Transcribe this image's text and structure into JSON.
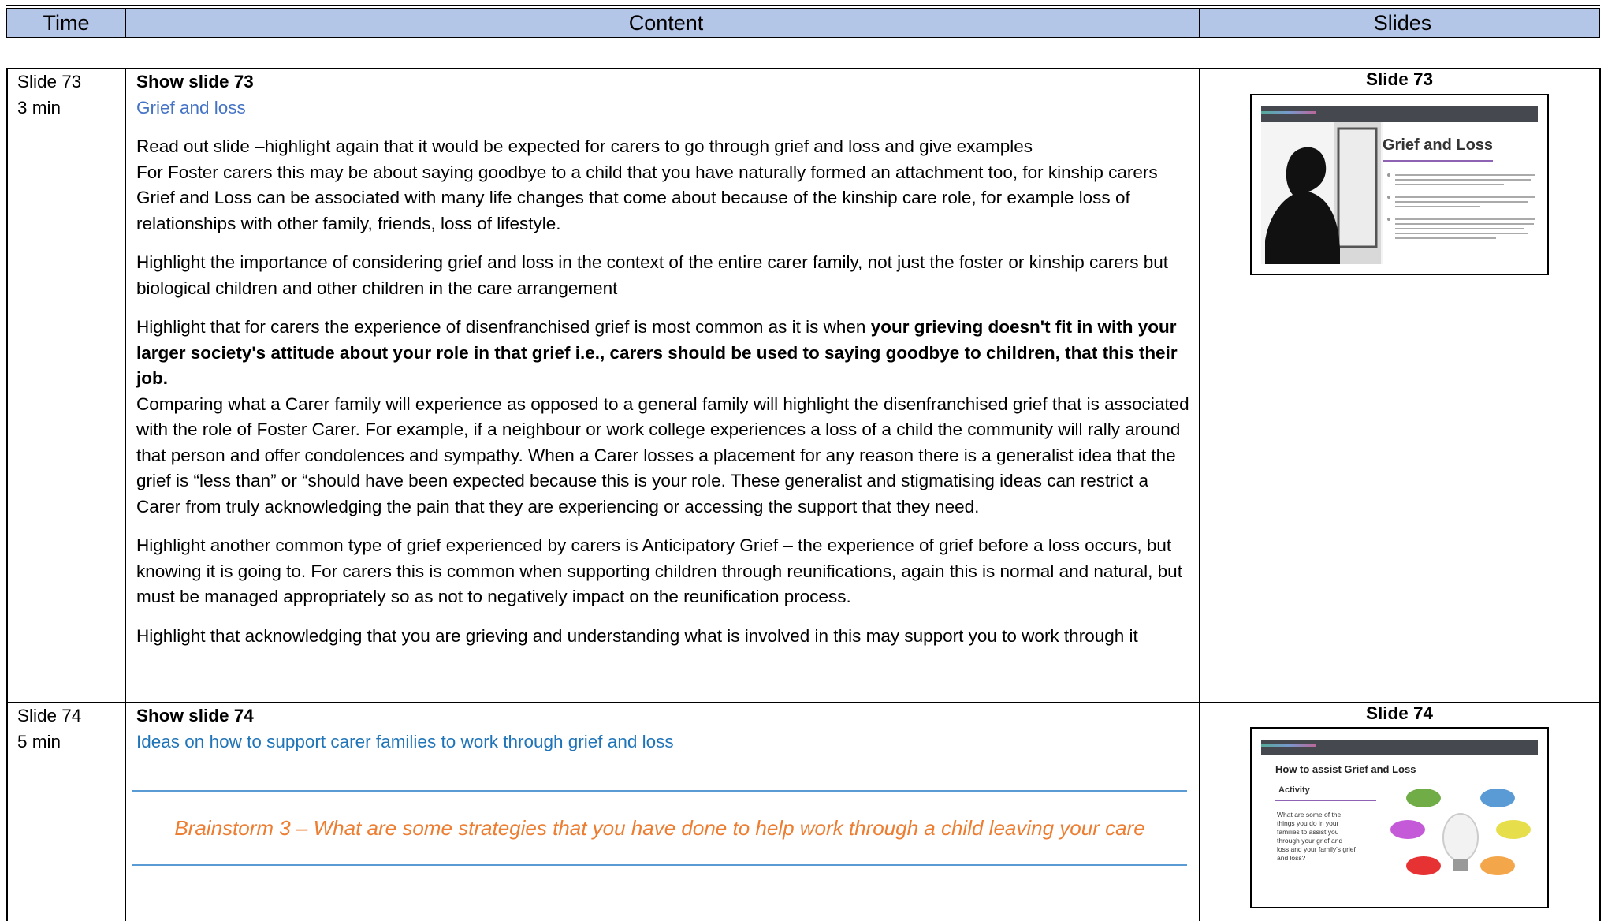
{
  "header": {
    "time": "Time",
    "content": "Content",
    "slides": "Slides"
  },
  "row73": {
    "time_slide": "Slide 73",
    "time_min": "3 min",
    "show": "Show slide 73",
    "subtitle": "Grief and loss",
    "p1_line1": "Read out slide –highlight again that it would be expected for carers to go through grief and loss and give examples",
    "p1_line2": "For Foster carers this may be about saying goodbye to a child that you have naturally formed an attachment too, for kinship carers Grief and Loss can be associated with many life changes that come about because of the kinship care role, for example loss of relationships with other family, friends, loss of lifestyle.",
    "p2": "Highlight the importance of considering grief and loss in the context of the entire carer family, not just the foster or kinship carers but biological children and other children in the care arrangement",
    "p3_plain": "Highlight that for carers the experience of disenfranchised grief is most common as it is when ",
    "p3_bold": "your grieving doesn't fit in with your larger society's attitude about your role in that grief i.e., carers should be used to saying goodbye to children, that this their job.",
    "p3_cont": "Comparing what a Carer family will experience as opposed to a general family will highlight the disenfranchised grief that is associated with the role of Foster Carer.  For example, if a neighbour or work college experiences a loss of a child the community will rally around that person and offer condolences and sympathy.  When a Carer losses a placement for any reason there is a generalist idea that the grief is “less than” or “should have been expected because this is your role. These generalist and stigmatising ideas can restrict a Carer from truly acknowledging the pain that they are experiencing or accessing the support that they need.",
    "p4": "Highlight another common type of grief experienced by carers is Anticipatory Grief – the experience of grief before a loss occurs, but knowing it is going to.  For carers this is common when supporting children through reunifications, again this is normal and natural, but must be managed appropriately so as not to negatively impact on the reunification process.",
    "p5": "Highlight that acknowledging that you are grieving and understanding what is involved in this may support you to work through it",
    "slide_label": "Slide 73",
    "thumb_title": "Grief and Loss"
  },
  "row74": {
    "time_slide": "Slide 74",
    "time_min": "5 min",
    "show": "Show slide 74",
    "subtitle": "Ideas on how to support carer families to work through grief and loss",
    "brainstorm": "Brainstorm 3 – What are some strategies that you have done to help work through a child leaving your care",
    "slide_label": "Slide 74",
    "thumb_title": "How to assist Grief and Loss",
    "thumb_activity": "Activity",
    "thumb_question": "What are some of the things you do in your families to assist you through your grief and loss and your family's grief and loss?"
  },
  "colors": {
    "header_bg": "#b4c6e7",
    "subtitle_blue": "#4472c4",
    "brainstorm_orange": "#ed7d31",
    "rule_blue": "#5b9bd5"
  }
}
